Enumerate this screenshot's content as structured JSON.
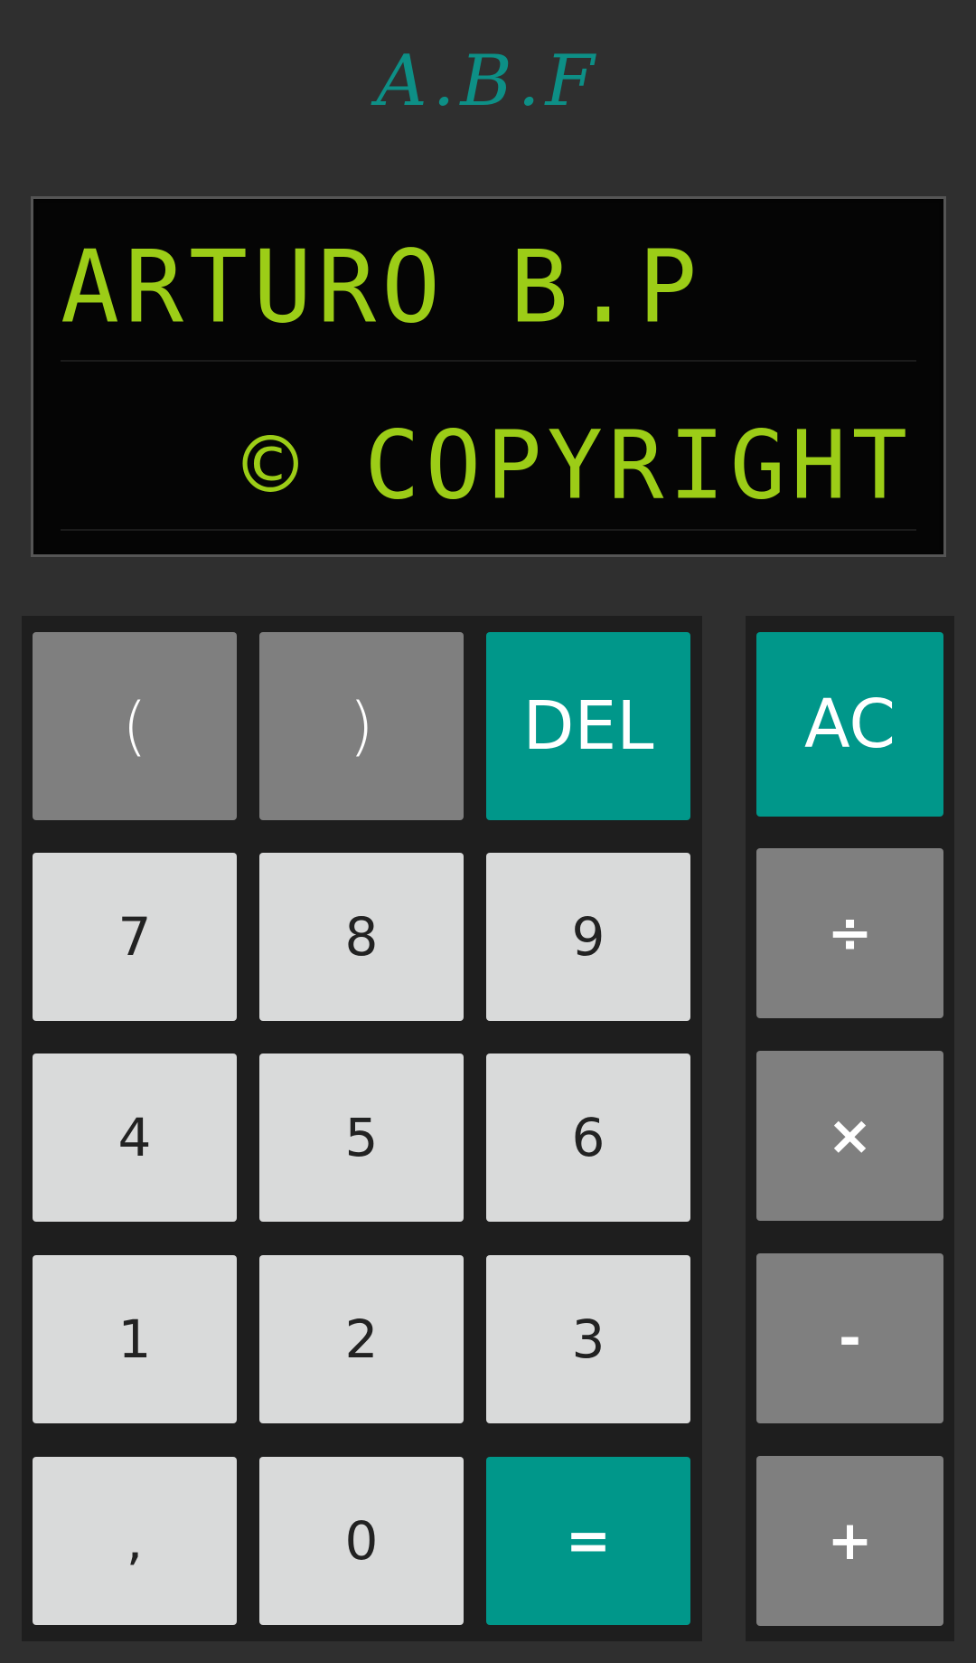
{
  "brand": {
    "title": "A.B.F"
  },
  "display": {
    "line1": "ARTURO B.P",
    "line2": "© COPYRIGHT"
  },
  "keys": {
    "paren_open": "(",
    "paren_close": ")",
    "del": "DEL",
    "ac": "AC",
    "seven": "7",
    "eight": "8",
    "nine": "9",
    "divide": "÷",
    "four": "4",
    "five": "5",
    "six": "6",
    "multiply": "×",
    "one": "1",
    "two": "2",
    "three": "3",
    "minus": "-",
    "comma": ",",
    "zero": "0",
    "equals": "=",
    "plus": "+"
  },
  "colors": {
    "background": "#2f2f2f",
    "lcd_text": "#9ccd17",
    "accent": "#00978a",
    "operator_key": "#7f7f7f",
    "digit_key": "#d9dada"
  }
}
